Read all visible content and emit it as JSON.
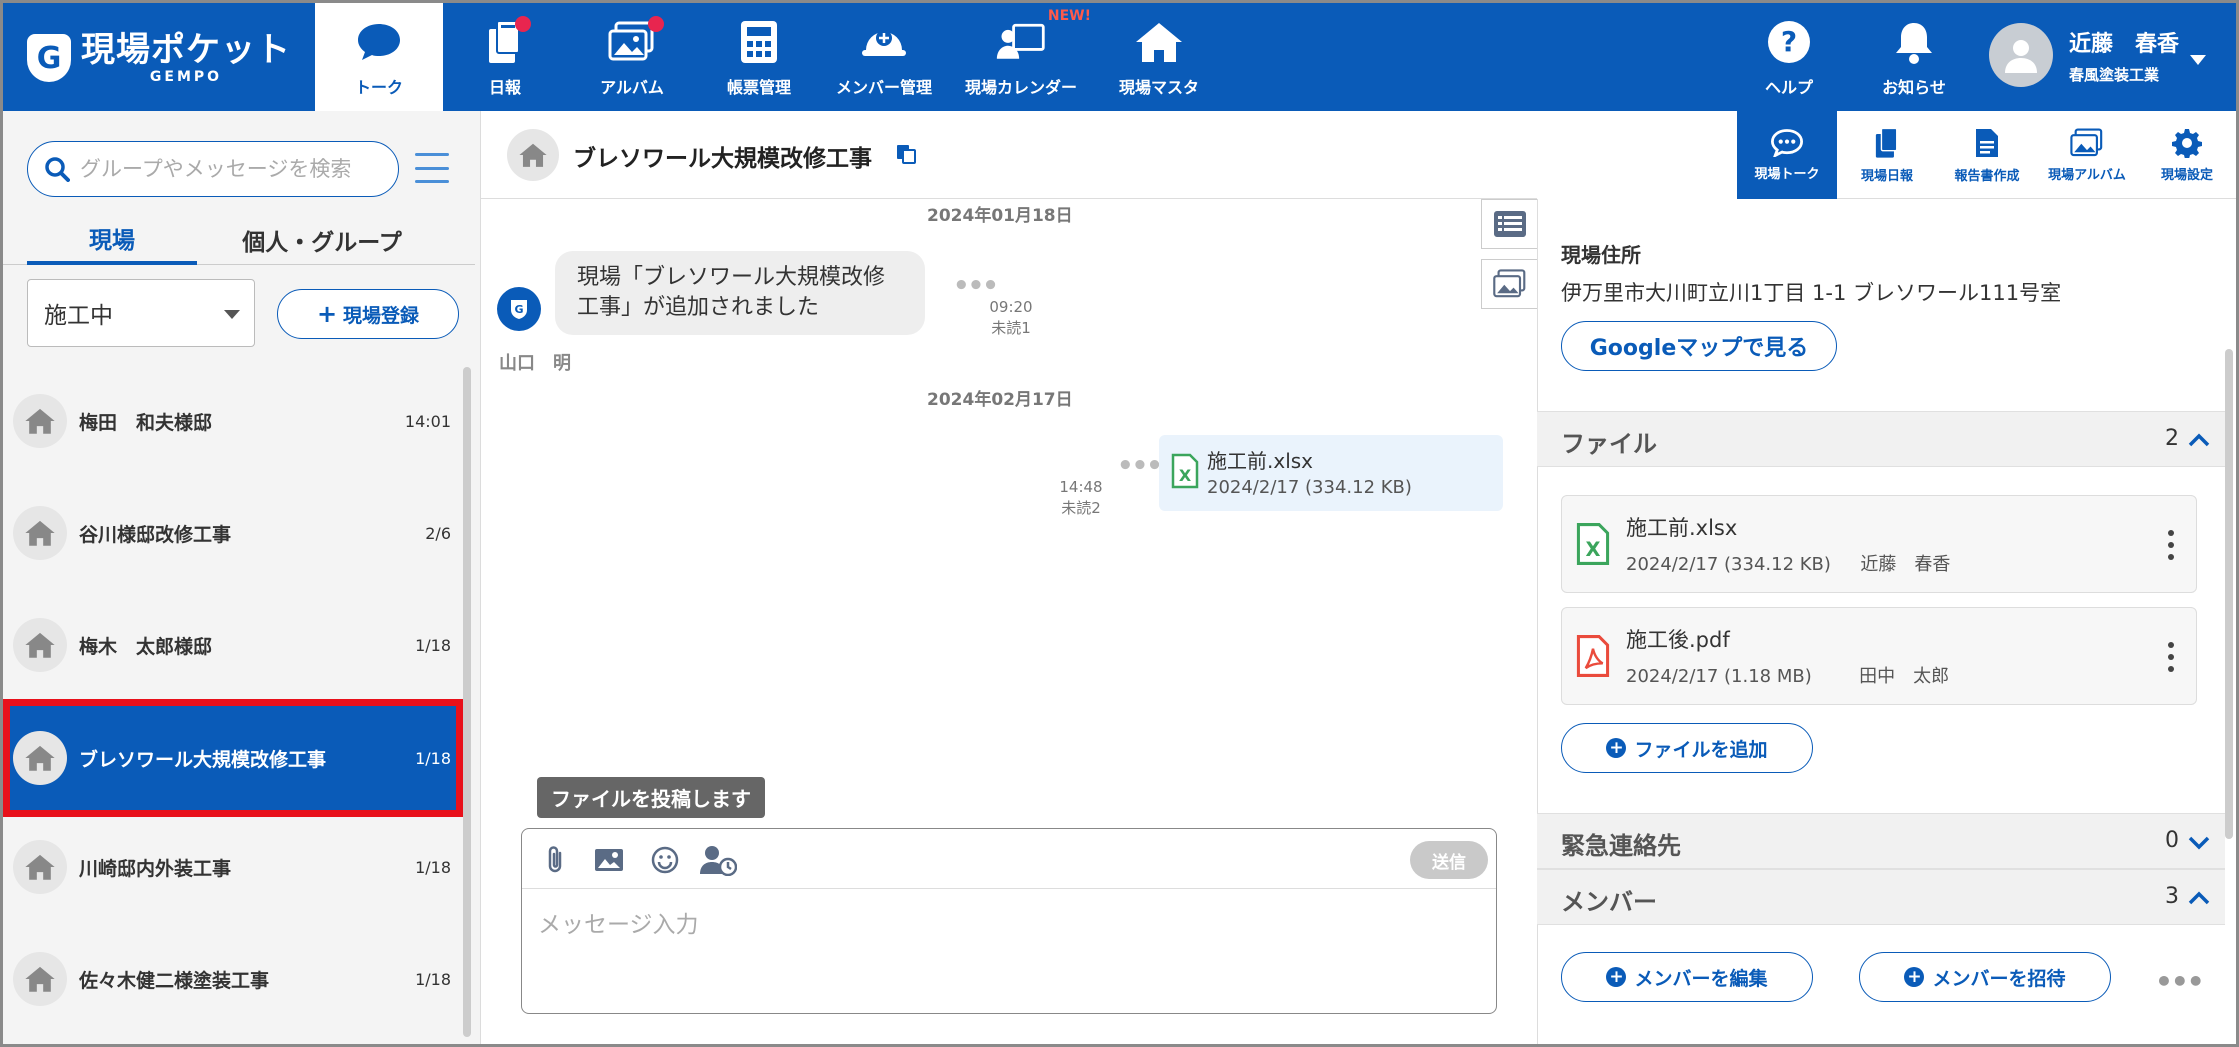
{
  "app": {
    "logo_main": "現場ポケット",
    "logo_sub": "GEMPO",
    "logo_mark": "G"
  },
  "nav": [
    {
      "label": "トーク",
      "icon": "chat-bubble-icon",
      "active": true
    },
    {
      "label": "日報",
      "icon": "daily-report-icon",
      "badge": true
    },
    {
      "label": "アルバム",
      "icon": "album-icon",
      "badge": true
    },
    {
      "label": "帳票管理",
      "icon": "calculator-icon"
    },
    {
      "label": "メンバー管理",
      "icon": "helmet-icon"
    },
    {
      "label": "現場カレンダー",
      "icon": "calendar-person-icon",
      "new": "NEW!"
    },
    {
      "label": "現場マスタ",
      "icon": "house-icon"
    }
  ],
  "header_right": {
    "help_label": "ヘルプ",
    "notice_label": "お知らせ",
    "user_name": "近藤　春香",
    "user_company": "春風塗装工業"
  },
  "sidebar": {
    "search_placeholder": "グループやメッセージを検索",
    "tab_site": "現場",
    "tab_group": "個人・グループ",
    "status_value": "施工中",
    "register_label": "現場登録",
    "sites": [
      {
        "name": "梅田　和夫様邸",
        "time": "14:01"
      },
      {
        "name": "谷川様邸改修工事",
        "time": "2/6"
      },
      {
        "name": "梅木　太郎様邸",
        "time": "1/18"
      },
      {
        "name": "ブレソワール大規模改修工事",
        "time": "1/18",
        "selected": true
      },
      {
        "name": "川崎邸内外装工事",
        "time": "1/18"
      },
      {
        "name": "佐々木健二様塗装工事",
        "time": "1/18"
      }
    ]
  },
  "chat": {
    "title": "ブレソワール大規模改修工事",
    "date1": "2024年01月18日",
    "system_msg_line1": "現場「ブレソワール大規模改修",
    "system_msg_line2": "工事」が追加されました",
    "msg1_time": "09:20",
    "msg1_unread": "未読1",
    "sender": "山口　明",
    "date2": "2024年02月17日",
    "file_msg_name": "施工前.xlsx",
    "file_msg_meta": "2024/2/17 (334.12 KB)",
    "msg2_time": "14:48",
    "msg2_unread": "未読2",
    "tooltip": "ファイルを投稿します",
    "send_label": "送信",
    "input_placeholder": "メッセージ入力"
  },
  "right_tabs": [
    {
      "label": "現場トーク",
      "icon": "chat-bubble-icon",
      "active": true
    },
    {
      "label": "現場日報",
      "icon": "daily-report-icon"
    },
    {
      "label": "報告書作成",
      "icon": "document-icon"
    },
    {
      "label": "現場アルバム",
      "icon": "album-icon"
    },
    {
      "label": "現場設定",
      "icon": "gear-icon"
    }
  ],
  "right_panel": {
    "address_label": "現場住所",
    "address": "伊万里市大川町立川1丁目 1-1 ブレソワール111号室",
    "gmap_label": "Googleマップで見る",
    "files_title": "ファイル",
    "files_count": "2",
    "files": [
      {
        "name": "施工前.xlsx",
        "meta": "2024/2/17 (334.12 KB)　  近藤　春香",
        "type": "xlsx"
      },
      {
        "name": "施工後.pdf",
        "meta": "2024/2/17 (1.18 MB)　　  田中　太郎",
        "type": "pdf"
      }
    ],
    "add_file_label": "ファイルを追加",
    "emergency_title": "緊急連絡先",
    "emergency_count": "0",
    "members_title": "メンバー",
    "members_count": "3",
    "edit_members_label": "メンバーを編集",
    "invite_members_label": "メンバーを招待"
  },
  "colors": {
    "brand_blue": "#0a5bb8",
    "selected_outline": "#e8101a",
    "badge_red": "#e8254f"
  }
}
